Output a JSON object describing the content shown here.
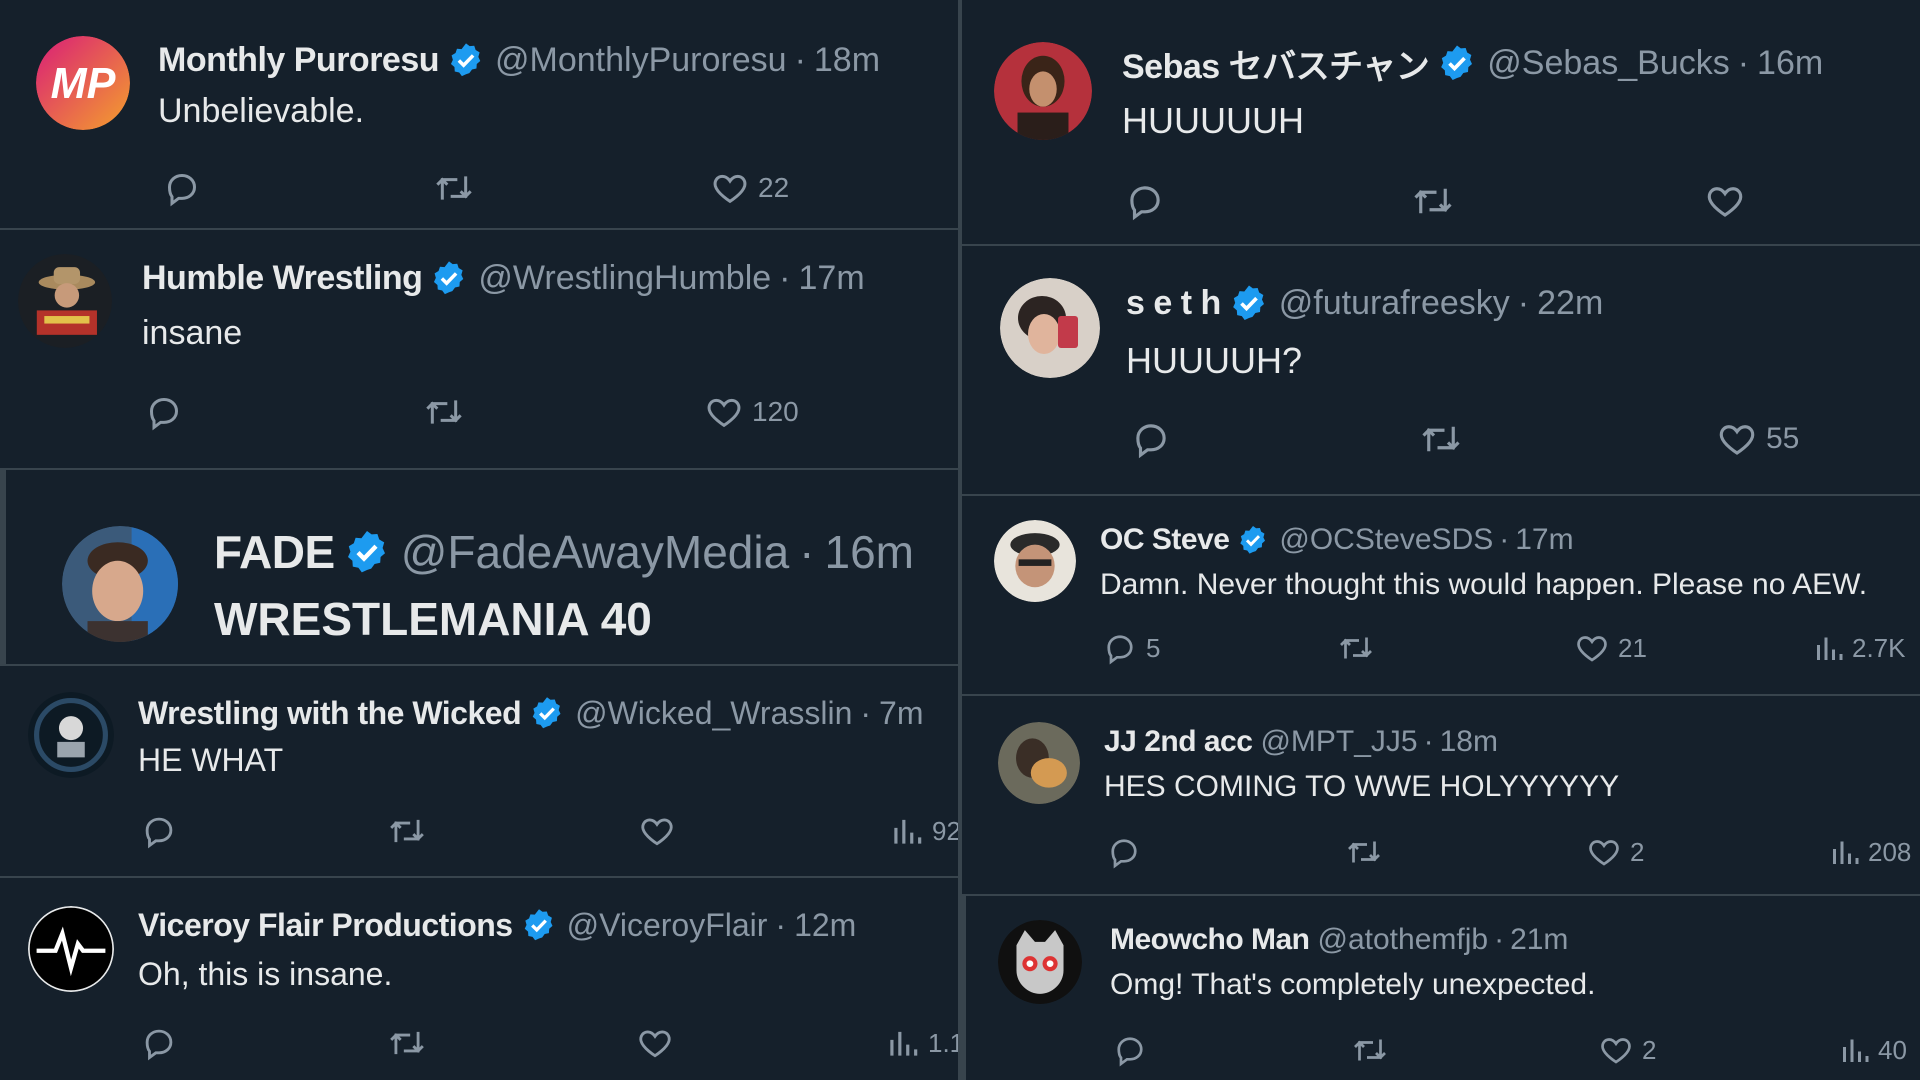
{
  "left": [
    {
      "name": "Monthly Puroresu",
      "handle": "@MonthlyPuroresu",
      "time": "18m",
      "text": "Unbelievable.",
      "replies": "",
      "retweets": "",
      "likes": "22",
      "views": ""
    },
    {
      "name": "Humble Wrestling",
      "handle": "@WrestlingHumble",
      "time": "17m",
      "text": "insane",
      "replies": "",
      "retweets": "",
      "likes": "120",
      "views": ""
    },
    {
      "name": "FADE",
      "handle": "@FadeAwayMedia",
      "time": "16m",
      "text": "WRESTLEMANIA 40"
    },
    {
      "name": "Wrestling with the Wicked",
      "handle": "@Wicked_Wrasslin",
      "time": "7m",
      "text": "HE WHAT",
      "likes": "",
      "views": "92"
    },
    {
      "name": "Viceroy Flair Productions",
      "handle": "@ViceroyFlair",
      "time": "12m",
      "text": "Oh, this is insane.",
      "likes": "",
      "views": "1.1"
    }
  ],
  "right": [
    {
      "name": "Sebas セバスチャン",
      "handle": "@Sebas_Bucks",
      "time": "16m",
      "text": "HUUUUUH",
      "likes": ""
    },
    {
      "name": "s e t h",
      "handle": "@futurafreesky",
      "time": "22m",
      "text": "HUUUUH?",
      "likes": "55"
    },
    {
      "name": "OC Steve",
      "handle": "@OCSteveSDS",
      "time": "17m",
      "text": "Damn. Never thought this would happen. Please no AEW.",
      "replies": "5",
      "likes": "21",
      "views": "2.7K"
    },
    {
      "name": "JJ 2nd acc",
      "handle": "@MPT_JJ5",
      "time": "18m",
      "text": "HES COMING TO WWE HOLYYYYYY",
      "likes": "2",
      "views": "208"
    },
    {
      "name": "Meowcho Man",
      "handle": "@atothemfjb",
      "time": "21m",
      "text": "Omg! That's completely unexpected.",
      "likes": "2",
      "views": "40"
    }
  ],
  "separator": "·",
  "colors": {
    "background": "#15202b",
    "divider": "#38444d",
    "text": "#e7e9ea",
    "muted": "#8b98a5",
    "verified": "#1d9bf0"
  },
  "icons": {
    "reply": "reply-icon",
    "retweet": "retweet-icon",
    "like": "heart-icon",
    "views": "views-icon",
    "verified": "verified-badge-icon"
  }
}
